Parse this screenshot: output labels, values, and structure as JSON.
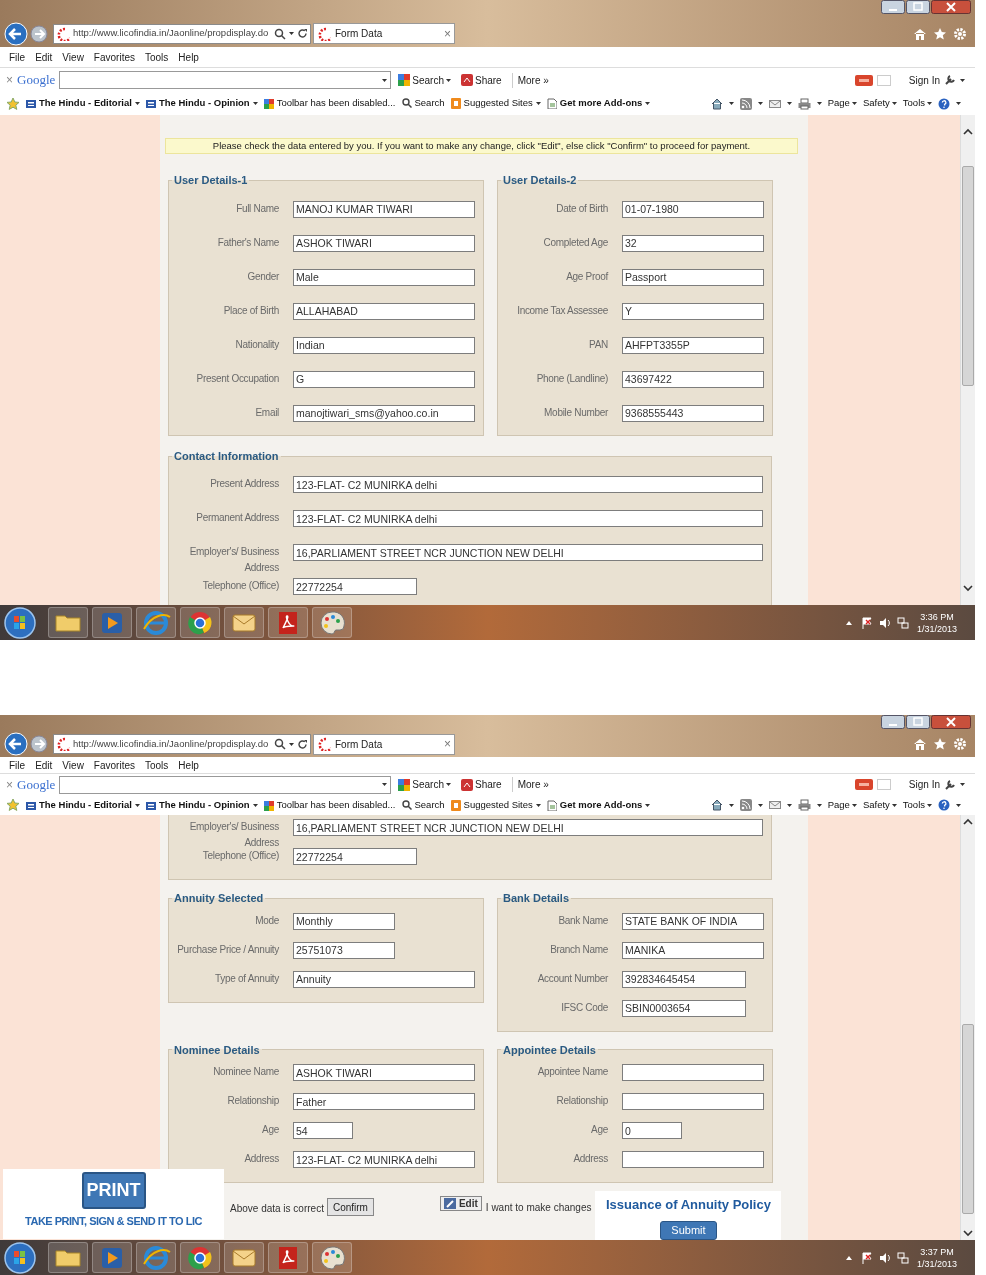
{
  "screens": [
    {
      "browser": {
        "address": "http://www.licofindia.in/Jaonline/propdisplay.do",
        "tab_title": "Form Data",
        "tab_close": "×",
        "menu": [
          "File",
          "Edit",
          "View",
          "Favorites",
          "Tools",
          "Help"
        ],
        "google": {
          "close": "×",
          "logo": "Google",
          "search": "Search",
          "share": "Share",
          "more": "More »",
          "sign_in": "Sign In"
        },
        "favorites": [
          {
            "label": "The Hindu - Editorial",
            "kind": "news",
            "dropdown": true
          },
          {
            "label": "The Hindu - Opinion",
            "kind": "news",
            "dropdown": true
          },
          {
            "label": "Toolbar has been disabled...",
            "kind": "tiles",
            "dropdown": false
          },
          {
            "label": "Search",
            "kind": "search",
            "dropdown": false
          },
          {
            "label": "Suggested Sites",
            "kind": "tag",
            "dropdown": true
          },
          {
            "label": "Get more Add-ons",
            "kind": "page",
            "dropdown": true
          }
        ],
        "commands": [
          "Page",
          "Safety",
          "Tools"
        ]
      },
      "notice": "Please check the data entered by you. If you want to make any change, click \"Edit\", else click \"Confirm\" to proceed for payment.",
      "section_rows": [
        [
          {
            "title": "User Details-1",
            "fields": [
              {
                "label": "Full Name",
                "value": "MANOJ KUMAR TIWARI",
                "kind": "full"
              },
              {
                "label": "Father's Name",
                "value": "ASHOK TIWARI",
                "kind": "full"
              },
              {
                "label": "Gender",
                "value": "Male",
                "kind": "full"
              },
              {
                "label": "Place of Birth",
                "value": "ALLAHABAD",
                "kind": "full"
              },
              {
                "label": "Nationality",
                "value": "Indian",
                "kind": "full"
              },
              {
                "label": "Present Occupation",
                "value": "G",
                "kind": "full"
              },
              {
                "label": "Email",
                "value": "manojtiwari_sms@yahoo.co.in",
                "kind": "full"
              }
            ]
          },
          {
            "title": "User Details-2",
            "fields": [
              {
                "label": "Date of Birth",
                "value": "01-07-1980",
                "kind": "full"
              },
              {
                "label": "Completed Age",
                "value": "32",
                "kind": "full"
              },
              {
                "label": "Age Proof",
                "value": "Passport",
                "kind": "full"
              },
              {
                "label": "Income Tax Assessee",
                "value": "Y",
                "kind": "full"
              },
              {
                "label": "PAN",
                "value": "AHFPT3355P",
                "kind": "full"
              },
              {
                "label": "Phone (Landline)",
                "value": "43697422",
                "kind": "full"
              },
              {
                "label": "Mobile Number",
                "value": "9368555443",
                "kind": "full"
              }
            ]
          }
        ],
        [
          {
            "title": "Contact Information",
            "fields": [
              {
                "label": "Present Address",
                "value": "123-FLAT- C2 MUNIRKA delhi",
                "kind": "full"
              },
              {
                "label": "Permanent Address",
                "value": "123-FLAT- C2 MUNIRKA delhi",
                "kind": "full"
              },
              {
                "label": "Employer's/ Business Address",
                "value": "16,PARLIAMENT STREET NCR JUNCTION NEW DELHI",
                "kind": "full"
              },
              {
                "label": "Telephone (Office)",
                "value": "22772254",
                "kind": "medium"
              }
            ]
          }
        ]
      ],
      "taskbar": {
        "time": "3:36 PM",
        "date": "1/31/2013"
      }
    },
    {
      "browser": {
        "address": "http://www.licofindia.in/Jaonline/propdisplay.do",
        "tab_title": "Form Data",
        "tab_close": "×",
        "menu": [
          "File",
          "Edit",
          "View",
          "Favorites",
          "Tools",
          "Help"
        ],
        "google": {
          "close": "×",
          "logo": "Google",
          "search": "Search",
          "share": "Share",
          "more": "More »",
          "sign_in": "Sign In"
        },
        "favorites": [
          {
            "label": "The Hindu - Editorial",
            "kind": "news",
            "dropdown": true
          },
          {
            "label": "The Hindu - Opinion",
            "kind": "news",
            "dropdown": true
          },
          {
            "label": "Toolbar has been disabled...",
            "kind": "tiles",
            "dropdown": false
          },
          {
            "label": "Search",
            "kind": "search",
            "dropdown": false
          },
          {
            "label": "Suggested Sites",
            "kind": "tag",
            "dropdown": true
          },
          {
            "label": "Get more Add-ons",
            "kind": "page",
            "dropdown": true
          }
        ],
        "commands": [
          "Page",
          "Safety",
          "Tools"
        ]
      },
      "section_rows": [
        [
          {
            "fields": [
              {
                "label": "Employer's/ Business Address",
                "value": "16,PARLIAMENT STREET NCR JUNCTION NEW DELHI",
                "kind": "full"
              },
              {
                "label": "Telephone (Office)",
                "value": "22772254",
                "kind": "medium"
              }
            ]
          }
        ],
        [
          {
            "title": "Annuity Selected",
            "fields": [
              {
                "label": "Mode",
                "value": "Monthly",
                "kind": "short"
              },
              {
                "label": "Purchase Price / Annuity",
                "value": "25751073",
                "kind": "short"
              },
              {
                "label": "Type of Annuity",
                "value": "Annuity",
                "kind": "full"
              }
            ]
          },
          {
            "title": "Bank Details",
            "fields": [
              {
                "label": "Bank Name",
                "value": "STATE BANK OF INDIA",
                "kind": "full"
              },
              {
                "label": "Branch Name",
                "value": "MANIKA",
                "kind": "full"
              },
              {
                "label": "Account Number",
                "value": "392834645454",
                "kind": "medium"
              },
              {
                "label": "IFSC Code",
                "value": "SBIN0003654",
                "kind": "medium"
              }
            ]
          }
        ],
        [
          {
            "title": "Nominee Details",
            "fields": [
              {
                "label": "Nominee Name",
                "value": "ASHOK TIWARI",
                "kind": "full"
              },
              {
                "label": "Relationship",
                "value": "Father",
                "kind": "full"
              },
              {
                "label": "Age",
                "value": "54",
                "kind": "tiny"
              },
              {
                "label": "Address",
                "value": "123-FLAT- C2 MUNIRKA delhi",
                "kind": "full"
              }
            ]
          },
          {
            "title": "Appointee Details",
            "fields": [
              {
                "label": "Appointee Name",
                "kind": "full"
              },
              {
                "label": "Relationship",
                "kind": "full"
              },
              {
                "label": "Age",
                "value": "0",
                "kind": "tiny"
              },
              {
                "label": "Address",
                "kind": "full"
              }
            ]
          }
        ]
      ],
      "actions": {
        "confirm_note": "Above data is correct",
        "confirm_button": "Confirm",
        "edit_button": "Edit",
        "edit_note": "I want to make changes",
        "issuance_title": "Issuance of Annuity Policy",
        "submit_button": "Submit"
      },
      "print_panel": {
        "button": "PRINT",
        "caption": "TAKE PRINT, SIGN & SEND IT TO LIC"
      },
      "taskbar": {
        "time": "3:37 PM",
        "date": "1/31/2013"
      }
    }
  ]
}
